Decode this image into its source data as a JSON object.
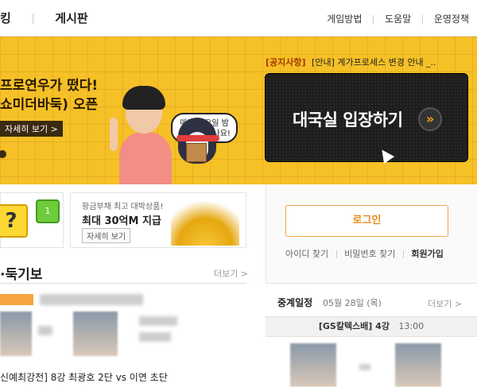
{
  "topnav": {
    "left_items": [
      "킹",
      "게시판"
    ],
    "right_items": [
      "게임방법",
      "도움말",
      "운영정책"
    ]
  },
  "banner": {
    "headline_1": "프로연우가 떴다!",
    "headline_2": "쇼미더바둑) 오픈",
    "more_label": "자세히 보기 >",
    "bubble_line_1": "매주 금요일 밤",
    "bubble_line_2": "10시에 만나요!"
  },
  "notice": {
    "tag": "[공지사항]",
    "text": "[안내] 계가프로세스 변경 안내 _.."
  },
  "enter_button": {
    "label": "대국실 입장하기",
    "icon": "double-chevron-right-icon"
  },
  "promo": {
    "quiz_icon": "question-mark-icon",
    "level_badge": "1",
    "small_text": "황금부채 최고 대박상품!",
    "big_text": "최대 30억M 지급",
    "more_label": "자세히 보기"
  },
  "news": {
    "section_title": "·둑기보",
    "more_label": "더보기 >",
    "headline": "신예최강전] 8강 최광호 2단 vs 이연 초단"
  },
  "login": {
    "button_label": "로그인",
    "find_id": "아이디 찾기",
    "find_pw": "비밀번호 찾기",
    "join": "회원가입"
  },
  "schedule": {
    "title": "중계일정",
    "date": "05월 28일 (목)",
    "more_label": "더보기 >",
    "match_name": "[GS칼텍스배] 4강",
    "match_time": "13:00"
  },
  "colors": {
    "banner_bg": "#f6c027",
    "accent_orange": "#f3a64a",
    "enter_bg": "#1d1d1d"
  }
}
